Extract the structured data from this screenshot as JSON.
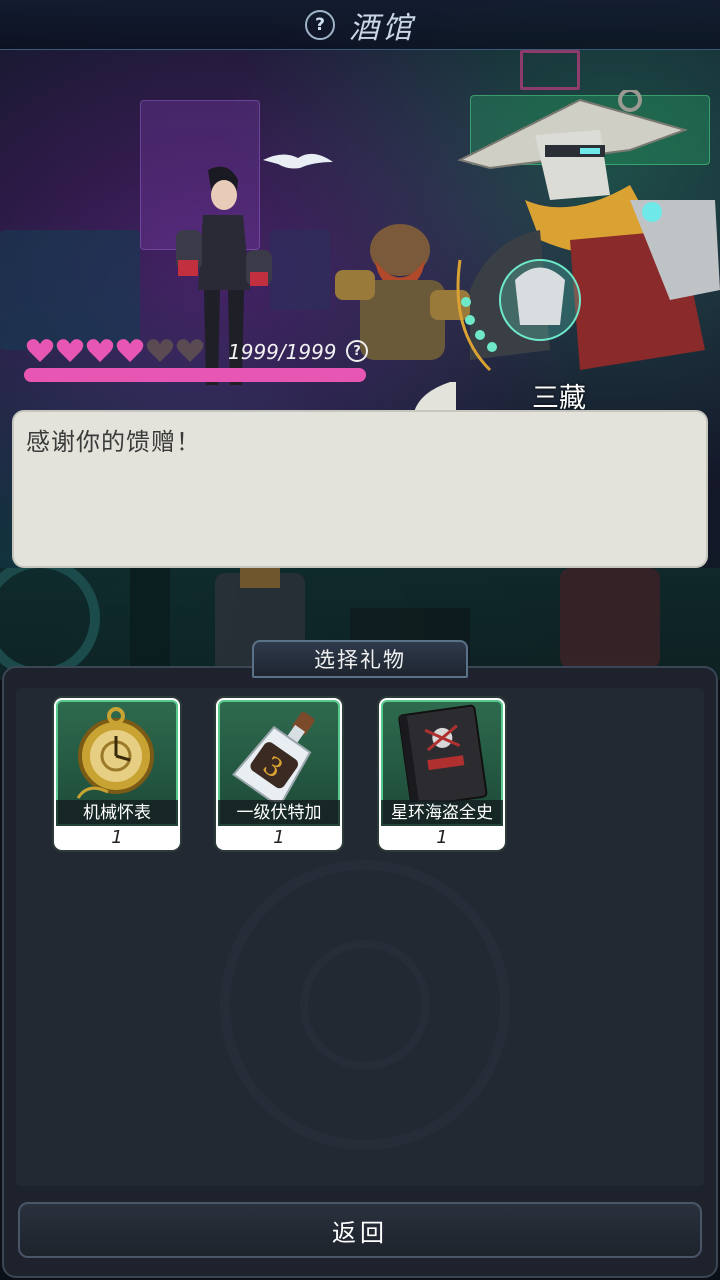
{
  "header": {
    "title": "酒馆",
    "help_icon": "?"
  },
  "character": {
    "name": "三藏",
    "affection_current": "1999/1999",
    "hearts_filled": 4,
    "hearts_total": 6,
    "affection_fraction": 1.0,
    "heart_color": "#e856b4",
    "heart_empty_color": "#5a4a52"
  },
  "dialog": {
    "text": "感谢你的馈赠！"
  },
  "gift_panel": {
    "tab_label": "选择礼物",
    "items": [
      {
        "name": "机械怀表",
        "count": "1",
        "icon": "pocket-watch-icon"
      },
      {
        "name": "一级伏特加",
        "count": "1",
        "icon": "vodka-bottle-icon"
      },
      {
        "name": "星环海盗全史",
        "count": "1",
        "icon": "pirate-book-icon"
      }
    ]
  },
  "footer": {
    "back_label": "返回"
  }
}
